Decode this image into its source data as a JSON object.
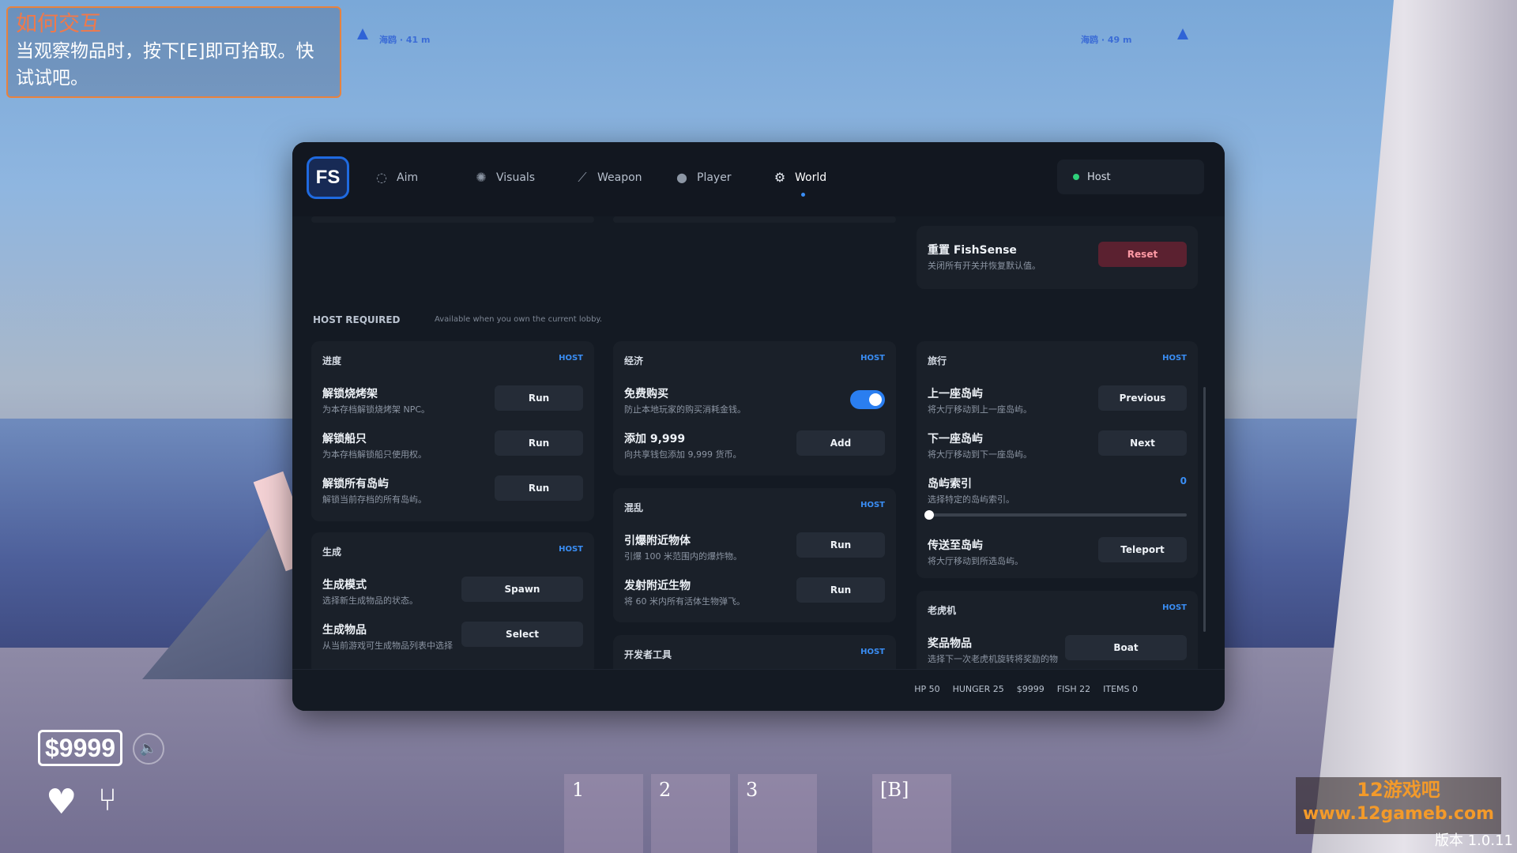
{
  "tutorial": {
    "title": "如何交互",
    "body": "当观察物品时，按下[E]即可拾取。快试试吧。"
  },
  "compass": {
    "left": "海鸥 · 41 m",
    "right": "海鸥 · 49 m"
  },
  "logo": "FS",
  "tabs": [
    {
      "label": "Aim",
      "icon": "crosshair-icon"
    },
    {
      "label": "Visuals",
      "icon": "sun-icon"
    },
    {
      "label": "Weapon",
      "icon": "blade-icon"
    },
    {
      "label": "Player",
      "icon": "user-icon"
    },
    {
      "label": "World",
      "icon": "gears-icon",
      "active": true
    }
  ],
  "host_pill": "Host",
  "reset_card": {
    "label": "重置 FishSense",
    "desc": "关闭所有开关并恢复默认值。",
    "button": "Reset"
  },
  "section": {
    "label": "HOST REQUIRED",
    "sub": "Available when you own the current lobby."
  },
  "host_tag": "HOST",
  "cards": {
    "progress": {
      "title": "进度",
      "rows": [
        {
          "label": "解锁烧烤架",
          "desc": "为本存档解锁烧烤架 NPC。",
          "button": "Run"
        },
        {
          "label": "解锁船只",
          "desc": "为本存档解锁船只使用权。",
          "button": "Run"
        },
        {
          "label": "解锁所有岛屿",
          "desc": "解锁当前存档的所有岛屿。",
          "button": "Run"
        }
      ]
    },
    "spawn": {
      "title": "生成",
      "rows": [
        {
          "label": "生成模式",
          "desc": "选择新生成物品的状态。",
          "button": "Spawn"
        },
        {
          "label": "生成物品",
          "desc": "从当前游戏可生成物品列表中选择",
          "button": "Select"
        }
      ]
    },
    "economy": {
      "title": "经济",
      "rows": [
        {
          "label": "免费购买",
          "desc": "防止本地玩家的购买消耗金钱。"
        },
        {
          "label": "添加 9,999",
          "desc": "向共享钱包添加 9,999 货币。",
          "button": "Add"
        }
      ]
    },
    "chaos": {
      "title": "混乱",
      "rows": [
        {
          "label": "引爆附近物体",
          "desc": "引爆 100 米范围内的爆炸物。",
          "button": "Run"
        },
        {
          "label": "发射附近生物",
          "desc": "将 60 米内所有活体生物弹飞。",
          "button": "Run"
        }
      ]
    },
    "dev": {
      "title": "开发者工具"
    },
    "travel": {
      "title": "旅行",
      "rows": [
        {
          "label": "上一座岛屿",
          "desc": "将大厅移动到上一座岛屿。",
          "button": "Previous"
        },
        {
          "label": "下一座岛屿",
          "desc": "将大厅移动到下一座岛屿。",
          "button": "Next"
        },
        {
          "label": "岛屿索引",
          "desc": "选择特定的岛屿索引。",
          "value": "0"
        },
        {
          "label": "传送至岛屿",
          "desc": "将大厅移动到所选岛屿。",
          "button": "Teleport"
        }
      ]
    },
    "slots": {
      "title": "老虎机",
      "rows": [
        {
          "label": "奖品物品",
          "desc": "选择下一次老虎机旋转将奖励的物",
          "button": "Boat"
        }
      ]
    }
  },
  "stats": [
    "HP 50",
    "HUNGER 25",
    "$9999",
    "FISH 22",
    "ITEMS 0"
  ],
  "hud": {
    "money": "$9999",
    "slots": [
      "1",
      "2",
      "3",
      "[B]"
    ]
  },
  "brand": {
    "line1": "12游戏吧",
    "line2": "www.12gameb.com"
  },
  "version": "版本  1.0.11",
  "colors": {
    "accent": "#3a8ef5",
    "reset": "#5b2130",
    "tutorial_border": "#e8823e"
  }
}
